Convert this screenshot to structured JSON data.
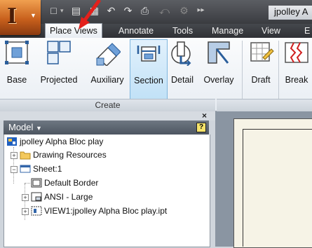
{
  "title_bar": {
    "document_title": "jpolley A",
    "quick_access": [
      "new-icon",
      "open-icon",
      "save-icon",
      "undo-icon",
      "redo-icon",
      "print-icon"
    ]
  },
  "ribbon_tabs": [
    {
      "label": "Place Views",
      "active": true
    },
    {
      "label": "Annotate",
      "active": false
    },
    {
      "label": "Tools",
      "active": false
    },
    {
      "label": "Manage",
      "active": false
    },
    {
      "label": "View",
      "active": false
    },
    {
      "label": "E",
      "active": false
    }
  ],
  "ribbon": {
    "panel_label": "Create",
    "buttons": [
      {
        "label": "Base",
        "icon": "base-view-icon"
      },
      {
        "label": "Projected",
        "icon": "projected-view-icon"
      },
      {
        "label": "Auxiliary",
        "icon": "auxiliary-view-icon"
      },
      {
        "label": "Section",
        "icon": "section-view-icon",
        "selected": true
      },
      {
        "label": "Detail",
        "icon": "detail-view-icon"
      },
      {
        "label": "Overlay",
        "icon": "overlay-view-icon"
      },
      {
        "label": "Draft",
        "icon": "draft-view-icon"
      },
      {
        "label": "Break",
        "icon": "break-icon"
      }
    ]
  },
  "browser": {
    "title": "Model",
    "help": "?",
    "close": "×",
    "tree": [
      {
        "label": "jpolley Alpha Bloc play"
      },
      {
        "label": "Drawing Resources"
      },
      {
        "label": "Sheet:1"
      },
      {
        "label": "Default Border"
      },
      {
        "label": "ANSI - Large"
      },
      {
        "label": "VIEW1:jpolley Alpha Bloc play.ipt"
      }
    ]
  },
  "colors": {
    "accent_selected": "#bfe0f6",
    "app_button": "#c8601c",
    "annotation_arrow": "#e3201b"
  }
}
